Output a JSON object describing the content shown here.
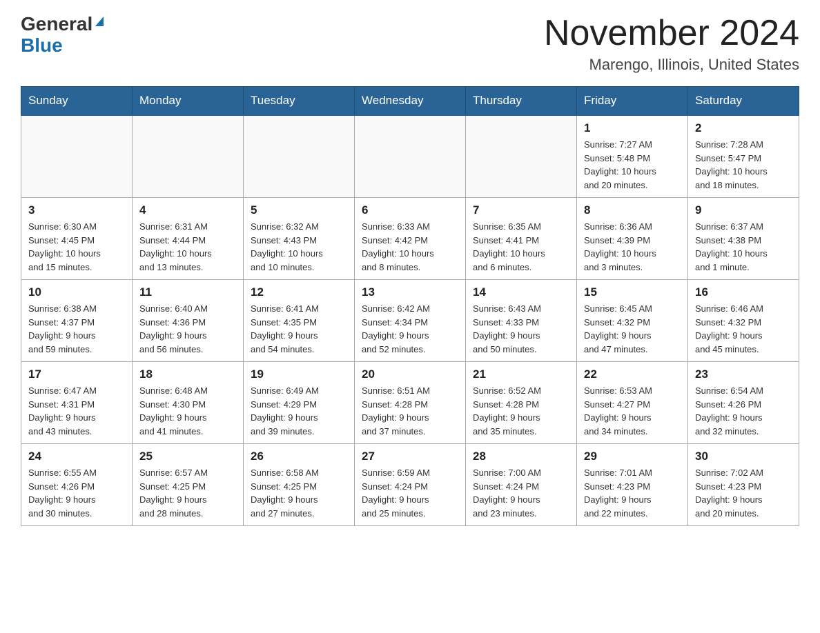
{
  "header": {
    "logo_general": "General",
    "logo_blue": "Blue",
    "month_title": "November 2024",
    "location": "Marengo, Illinois, United States"
  },
  "days_of_week": [
    "Sunday",
    "Monday",
    "Tuesday",
    "Wednesday",
    "Thursday",
    "Friday",
    "Saturday"
  ],
  "weeks": [
    [
      {
        "day": "",
        "info": ""
      },
      {
        "day": "",
        "info": ""
      },
      {
        "day": "",
        "info": ""
      },
      {
        "day": "",
        "info": ""
      },
      {
        "day": "",
        "info": ""
      },
      {
        "day": "1",
        "info": "Sunrise: 7:27 AM\nSunset: 5:48 PM\nDaylight: 10 hours\nand 20 minutes."
      },
      {
        "day": "2",
        "info": "Sunrise: 7:28 AM\nSunset: 5:47 PM\nDaylight: 10 hours\nand 18 minutes."
      }
    ],
    [
      {
        "day": "3",
        "info": "Sunrise: 6:30 AM\nSunset: 4:45 PM\nDaylight: 10 hours\nand 15 minutes."
      },
      {
        "day": "4",
        "info": "Sunrise: 6:31 AM\nSunset: 4:44 PM\nDaylight: 10 hours\nand 13 minutes."
      },
      {
        "day": "5",
        "info": "Sunrise: 6:32 AM\nSunset: 4:43 PM\nDaylight: 10 hours\nand 10 minutes."
      },
      {
        "day": "6",
        "info": "Sunrise: 6:33 AM\nSunset: 4:42 PM\nDaylight: 10 hours\nand 8 minutes."
      },
      {
        "day": "7",
        "info": "Sunrise: 6:35 AM\nSunset: 4:41 PM\nDaylight: 10 hours\nand 6 minutes."
      },
      {
        "day": "8",
        "info": "Sunrise: 6:36 AM\nSunset: 4:39 PM\nDaylight: 10 hours\nand 3 minutes."
      },
      {
        "day": "9",
        "info": "Sunrise: 6:37 AM\nSunset: 4:38 PM\nDaylight: 10 hours\nand 1 minute."
      }
    ],
    [
      {
        "day": "10",
        "info": "Sunrise: 6:38 AM\nSunset: 4:37 PM\nDaylight: 9 hours\nand 59 minutes."
      },
      {
        "day": "11",
        "info": "Sunrise: 6:40 AM\nSunset: 4:36 PM\nDaylight: 9 hours\nand 56 minutes."
      },
      {
        "day": "12",
        "info": "Sunrise: 6:41 AM\nSunset: 4:35 PM\nDaylight: 9 hours\nand 54 minutes."
      },
      {
        "day": "13",
        "info": "Sunrise: 6:42 AM\nSunset: 4:34 PM\nDaylight: 9 hours\nand 52 minutes."
      },
      {
        "day": "14",
        "info": "Sunrise: 6:43 AM\nSunset: 4:33 PM\nDaylight: 9 hours\nand 50 minutes."
      },
      {
        "day": "15",
        "info": "Sunrise: 6:45 AM\nSunset: 4:32 PM\nDaylight: 9 hours\nand 47 minutes."
      },
      {
        "day": "16",
        "info": "Sunrise: 6:46 AM\nSunset: 4:32 PM\nDaylight: 9 hours\nand 45 minutes."
      }
    ],
    [
      {
        "day": "17",
        "info": "Sunrise: 6:47 AM\nSunset: 4:31 PM\nDaylight: 9 hours\nand 43 minutes."
      },
      {
        "day": "18",
        "info": "Sunrise: 6:48 AM\nSunset: 4:30 PM\nDaylight: 9 hours\nand 41 minutes."
      },
      {
        "day": "19",
        "info": "Sunrise: 6:49 AM\nSunset: 4:29 PM\nDaylight: 9 hours\nand 39 minutes."
      },
      {
        "day": "20",
        "info": "Sunrise: 6:51 AM\nSunset: 4:28 PM\nDaylight: 9 hours\nand 37 minutes."
      },
      {
        "day": "21",
        "info": "Sunrise: 6:52 AM\nSunset: 4:28 PM\nDaylight: 9 hours\nand 35 minutes."
      },
      {
        "day": "22",
        "info": "Sunrise: 6:53 AM\nSunset: 4:27 PM\nDaylight: 9 hours\nand 34 minutes."
      },
      {
        "day": "23",
        "info": "Sunrise: 6:54 AM\nSunset: 4:26 PM\nDaylight: 9 hours\nand 32 minutes."
      }
    ],
    [
      {
        "day": "24",
        "info": "Sunrise: 6:55 AM\nSunset: 4:26 PM\nDaylight: 9 hours\nand 30 minutes."
      },
      {
        "day": "25",
        "info": "Sunrise: 6:57 AM\nSunset: 4:25 PM\nDaylight: 9 hours\nand 28 minutes."
      },
      {
        "day": "26",
        "info": "Sunrise: 6:58 AM\nSunset: 4:25 PM\nDaylight: 9 hours\nand 27 minutes."
      },
      {
        "day": "27",
        "info": "Sunrise: 6:59 AM\nSunset: 4:24 PM\nDaylight: 9 hours\nand 25 minutes."
      },
      {
        "day": "28",
        "info": "Sunrise: 7:00 AM\nSunset: 4:24 PM\nDaylight: 9 hours\nand 23 minutes."
      },
      {
        "day": "29",
        "info": "Sunrise: 7:01 AM\nSunset: 4:23 PM\nDaylight: 9 hours\nand 22 minutes."
      },
      {
        "day": "30",
        "info": "Sunrise: 7:02 AM\nSunset: 4:23 PM\nDaylight: 9 hours\nand 20 minutes."
      }
    ]
  ]
}
